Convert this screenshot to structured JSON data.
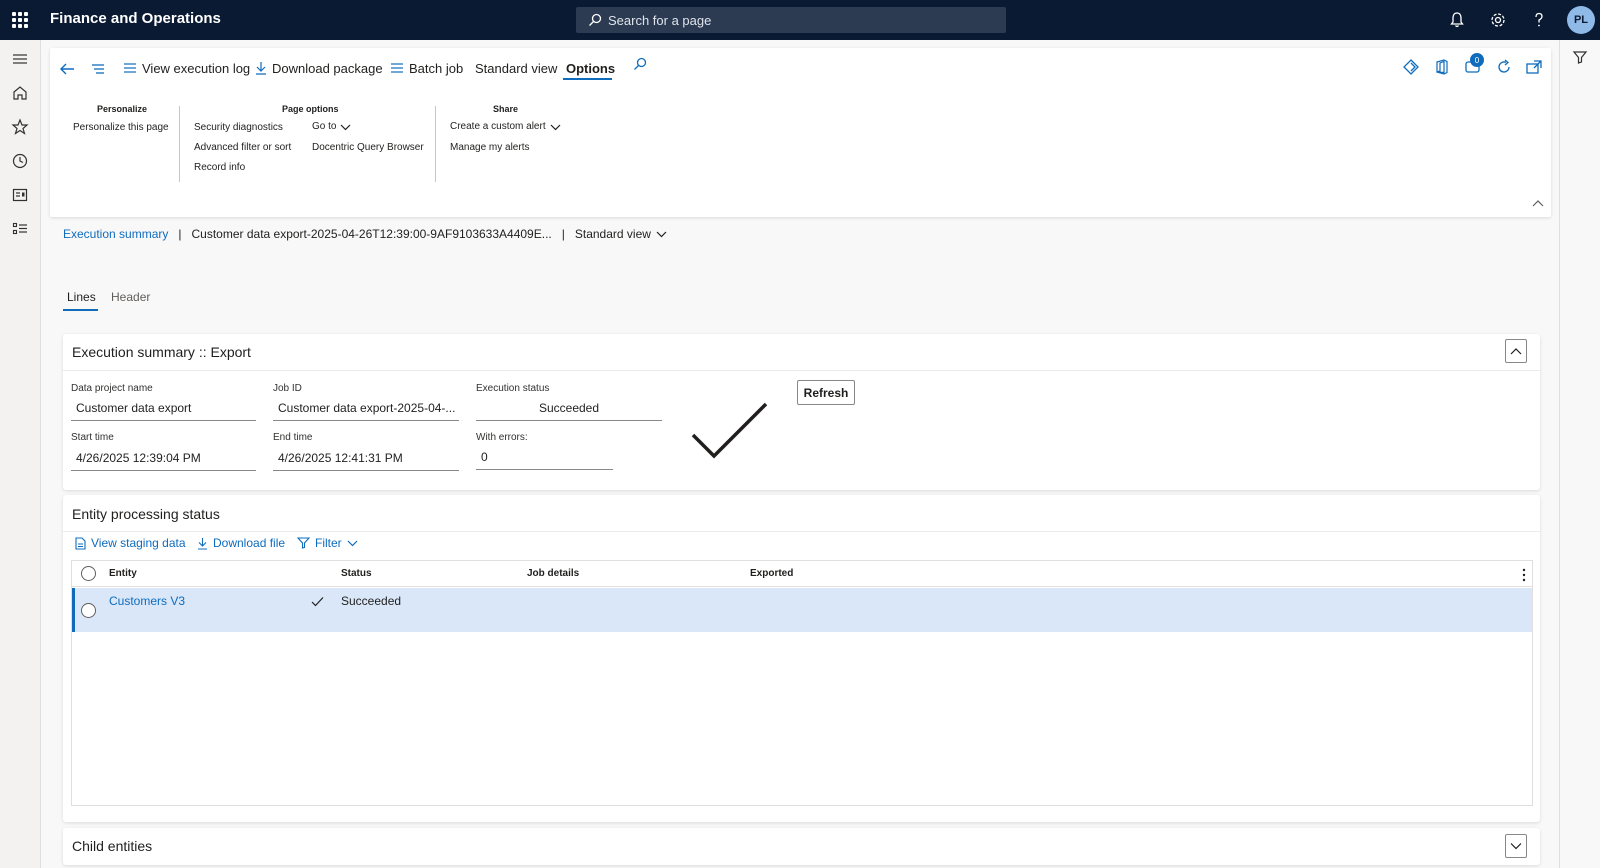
{
  "topbar": {
    "app_title": "Finance and Operations",
    "search_placeholder": "Search for a page",
    "avatar_initials": "PL"
  },
  "actionpane": {
    "buttons": {
      "view_log": "View execution log",
      "download_package": "Download package",
      "batch_job": "Batch job",
      "standard_view": "Standard view",
      "options": "Options"
    },
    "notification_count": "0",
    "groups": {
      "personalize": {
        "title": "Personalize",
        "items": [
          "Personalize this page"
        ]
      },
      "page_options": {
        "title": "Page options",
        "items": [
          "Security diagnostics",
          "Advanced filter or sort",
          "Record info",
          "Go to",
          "Docentric Query Browser"
        ]
      },
      "share": {
        "title": "Share",
        "items": [
          "Create a custom alert",
          "Manage my alerts"
        ]
      }
    }
  },
  "breadcrumb": {
    "link": "Execution summary",
    "separator": "|",
    "record": "Customer data export-2025-04-26T12:39:00-9AF9103633A4409E...",
    "view": "Standard view"
  },
  "tabs": [
    "Lines",
    "Header"
  ],
  "summary": {
    "title": "Execution summary :: Export",
    "fields": {
      "project_name": {
        "label": "Data project name",
        "value": "Customer data export"
      },
      "job_id": {
        "label": "Job ID",
        "value": "Customer data export-2025-04-..."
      },
      "status": {
        "label": "Execution status",
        "value": "Succeeded"
      },
      "start_time": {
        "label": "Start time",
        "value": "4/26/2025 12:39:04 PM"
      },
      "end_time": {
        "label": "End time",
        "value": "4/26/2025 12:41:31 PM"
      },
      "with_errors": {
        "label": "With errors:",
        "value": "0"
      }
    },
    "refresh_label": "Refresh"
  },
  "entity_status": {
    "title": "Entity processing status",
    "toolbar": {
      "view_staging": "View staging data",
      "download_file": "Download file",
      "filter": "Filter"
    },
    "columns": [
      "Entity",
      "Status",
      "Job details",
      "Exported"
    ],
    "rows": [
      {
        "entity": "Customers V3",
        "status": "Succeeded",
        "job_details": "",
        "exported": ""
      }
    ]
  },
  "child_entities": {
    "title": "Child entities"
  },
  "colors": {
    "topbar": "#0b1a33",
    "accent": "#0f6cbd",
    "selected_row": "#d9e7f8"
  }
}
